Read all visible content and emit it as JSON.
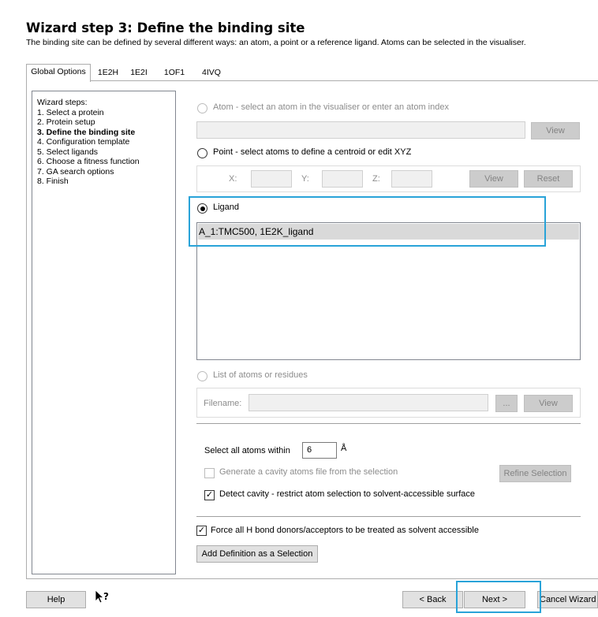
{
  "header": {
    "title": "Wizard step 3: Define the binding site",
    "subtitle": "The binding site can be defined by several different ways: an atom, a point or a reference ligand. Atoms can be selected in the visualiser."
  },
  "tabs": [
    {
      "label": "Global Options",
      "active": true
    },
    {
      "label": "1E2H",
      "active": false
    },
    {
      "label": "1E2I",
      "active": false
    },
    {
      "label": "1OF1",
      "active": false
    },
    {
      "label": "4IVQ",
      "active": false
    }
  ],
  "steps": {
    "heading": "Wizard steps:",
    "items": [
      "1. Select a protein",
      "2. Protein setup",
      "3. Define the binding site",
      "4. Configuration template",
      "5. Select ligands",
      "6. Choose a fitness function",
      "7. GA search options",
      "8. Finish"
    ]
  },
  "atom": {
    "label": "Atom - select an atom in the visualiser or enter an atom index",
    "value": "",
    "view_label": "View"
  },
  "point": {
    "label": "Point - select atoms to define a centroid or edit XYZ",
    "x_label": "X:",
    "y_label": "Y:",
    "z_label": "Z:",
    "x_value": "",
    "y_value": "",
    "z_value": "",
    "view_label": "View",
    "reset_label": "Reset"
  },
  "ligand": {
    "label": "Ligand",
    "items": [
      "A_1:TMC500, 1E2K_ligand"
    ]
  },
  "atoms_list": {
    "label": "List of atoms or residues",
    "filename_label": "Filename:",
    "filename_value": "",
    "browse_label": "...",
    "view_label": "View"
  },
  "selection": {
    "within_label": "Select all atoms within",
    "within_value": "6",
    "unit": "Å",
    "cavity_file_label": "Generate a cavity atoms file from the selection",
    "refine_label": "Refine Selection",
    "detect_label": "Detect cavity - restrict atom selection to solvent-accessible surface",
    "detect_checked": true
  },
  "force_hbond_label": "Force all H bond donors/acceptors to be treated as solvent accessible",
  "force_hbond_checked": true,
  "add_definition_label": "Add Definition as a Selection",
  "footer": {
    "help_label": "Help",
    "back_label": "< Back",
    "next_label": "Next >",
    "cancel_label": "Cancel Wizard"
  },
  "colors": {
    "highlight": "#29a3d8",
    "selected_row": "#d9d9d9"
  }
}
